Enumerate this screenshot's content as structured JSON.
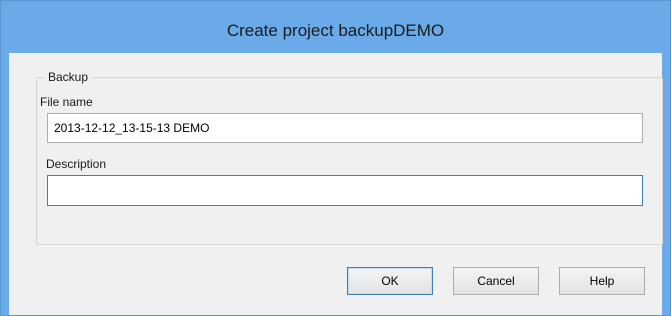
{
  "window": {
    "title": "Create project backupDEMO"
  },
  "backup_group": {
    "legend": "Backup",
    "file_name_label": "File name",
    "file_name_value": "2013-12-12_13-15-13 DEMO",
    "description_label": "Description",
    "description_value": ""
  },
  "buttons": {
    "ok": "OK",
    "cancel": "Cancel",
    "help": "Help"
  }
}
